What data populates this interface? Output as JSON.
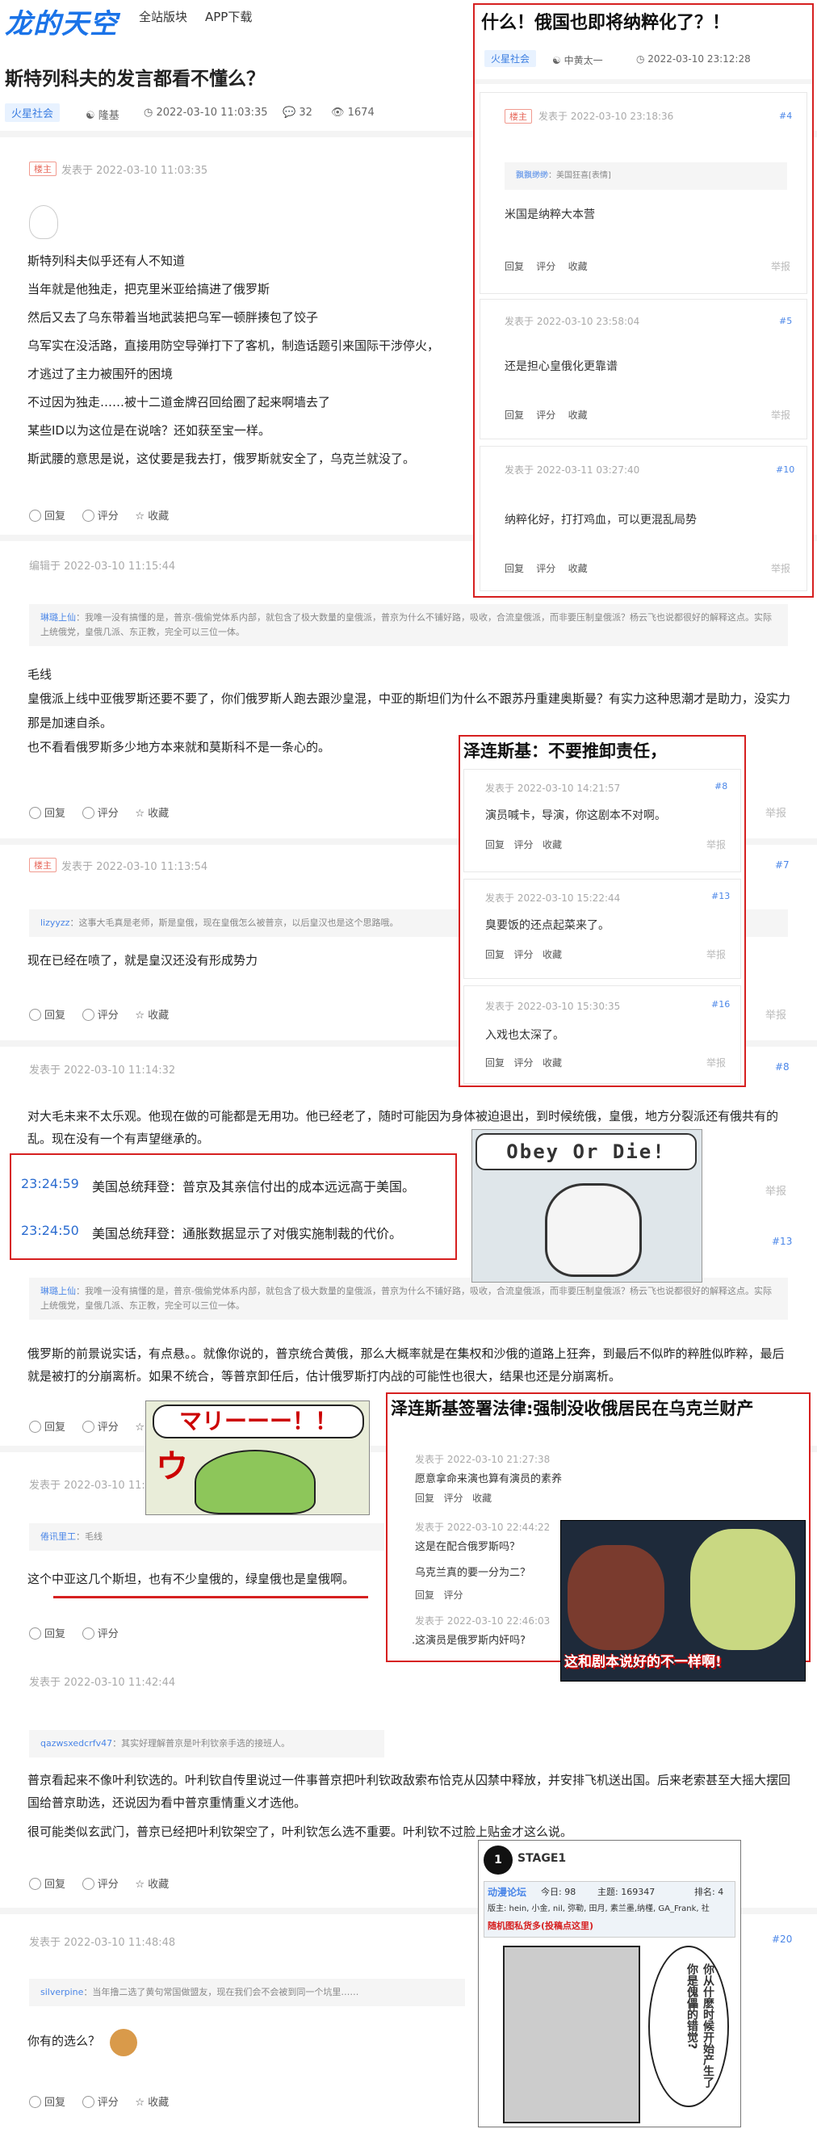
{
  "header": {
    "logo": "龙的天空",
    "nav": [
      "全站版块",
      "APP下载"
    ]
  },
  "page": {
    "title": "斯特列科夫的发言都看不懂么？",
    "tag": "火星社会",
    "author": "隆基",
    "time": "2022-03-10 11:03:35",
    "comments": "32",
    "views": "1674"
  },
  "common": {
    "louzhu": "楼主",
    "reply": "回复",
    "rate": "评分",
    "fav": "收藏",
    "report": "举报",
    "posted": "发表于"
  },
  "posts": [
    {
      "louzhu": true,
      "time": "发表于 2022-03-10 11:03:35",
      "lines": [
        "斯特列科夫似乎还有人不知道",
        "当年就是他独走，把克里米亚给搞进了俄罗斯",
        "然后又去了乌东带着当地武装把乌军一顿胖揍包了饺子",
        "乌军实在没活路，直接用防空导弹打下了客机，制造话题引来国际干涉停火，",
        "才逃过了主力被围歼的困境",
        "不过因为独走……被十二道金牌召回给圈了起来啊墙去了",
        "某些ID以为这位是在说啥？还如获至宝一样。",
        "斯武腰的意思是说，这仗要是我去打，俄罗斯就安全了，乌克兰就没了。"
      ]
    },
    {
      "time": "编辑于 2022-03-10 11:15:44",
      "quote_user": "琳璐上仙",
      "quote_text": "我唯一没有搞懂的是，普京-俄偷党体系内部，就包含了极大数量的皇俄派，普京为什么不铺好路，吸收，合流皇俄派，而非要压制皇俄派？杨云飞也说都很好的解释这点。实际上统俄党，皇俄几派、东正教，完全可以三位一体。",
      "lines": [
        "毛线",
        "皇俄派上线中亚俄罗斯还要不要了，你们俄罗斯人跑去跟沙皇混，中亚的斯坦们为什么不跟苏丹重建奥斯曼？有实力这种思潮才是助力，没实力那是加速自杀。",
        "也不看看俄罗斯多少地方本来就和莫斯科不是一条心的。"
      ]
    },
    {
      "louzhu": true,
      "time": "发表于 2022-03-10 11:13:54",
      "num": "#7",
      "quote_user": "lizyyzz",
      "quote_text": "这事大毛真是老师，斯是皇俄，现在皇俄怎么被普京，以后皇汉也是这个思路哦。",
      "lines": [
        "现在已经在喷了，就是皇汉还没有形成势力"
      ]
    },
    {
      "time": "发表于 2022-03-10 11:14:32",
      "num": "#8",
      "lines": [
        "对大毛未来不太乐观。他现在做的可能都是无用功。他已经老了，随时可能因为身体被迫退出，到时候统俄，皇俄，地方分裂派还有俄共有的乱。现在没有一个有声望继承的。"
      ]
    },
    {
      "num": "#13",
      "quote_user": "琳璐上仙",
      "quote_text": "我唯一没有搞懂的是，普京-俄偷党体系内部，就包含了极大数量的皇俄派，普京为什么不铺好路，吸收，合流皇俄派，而非要压制皇俄派？杨云飞也说都很好的解释这点。实际上统俄党，皇俄几派、东正教，完全可以三位一体。",
      "lines": [
        "俄罗斯的前景说实话，有点悬。。就像你说的，普京统合黄俄，那么大概率就是在集权和沙俄的道路上狂奔，到最后不似昨的粹胜似昨粹，最后就是被打的分崩离析。如果不统合，等普京卸任后，估计俄罗斯打内战的可能性也很大，结果也还是分崩离析。"
      ]
    },
    {
      "time": "发表于 2022-03-10 11:3",
      "quote_user": "倦讯里工",
      "quote_text": "毛线",
      "lines": [
        "这个中亚这几个斯坦，也有不少皇俄的，绿皇俄也是皇俄啊。"
      ]
    },
    {
      "time": "发表于 2022-03-10 11:42:44",
      "quote_user": "qazwsxedcrfv47",
      "quote_text": "其实好理解普京是叶利钦亲手选的接班人。",
      "lines": [
        "普京看起来不像叶利钦选的。叶利钦自传里说过一件事普京把叶利钦政敌索布恰克从囚禁中释放，并安排飞机送出国。后来老索甚至大摇大摆回国给普京助选，还说因为看中普京重情重义才选他。",
        "很可能类似玄武门，普京已经把叶利钦架空了，叶利钦怎么选不重要。叶利钦不过脸上贴金才这么说。"
      ]
    },
    {
      "time": "发表于 2022-03-10 11:48:48",
      "num": "#20",
      "quote_user": "silverpine",
      "quote_text": "当年撸二选了黄句常国做盟友，现在我们会不会被到同一个坑里……",
      "lines": [
        "你有的选么？"
      ]
    }
  ],
  "overlays": {
    "box1": {
      "title": "什么！俄国也即将纳粹化了？！",
      "tag": "火星社会",
      "author": "中黄太一",
      "time": "2022-03-10 23:12:28",
      "cards": [
        {
          "louzhu": true,
          "time": "发表于 2022-03-10 23:18:36",
          "num": "#4",
          "quote_user": "飘飘缈缈",
          "quote_text": "美国狂喜[表情]",
          "text": "米国是纳粹大本营"
        },
        {
          "time": "发表于 2022-03-10 23:58:04",
          "num": "#5",
          "text": "还是担心皇俄化更靠谱"
        },
        {
          "time": "发表于 2022-03-11 03:27:40",
          "num": "#10",
          "text": "纳粹化好，打打鸡血，可以更混乱局势"
        }
      ]
    },
    "box2": {
      "title": "泽连斯基：不要推卸责任，",
      "cards": [
        {
          "time": "发表于 2022-03-10 14:21:57",
          "num": "#8",
          "text": "演员喊卡，导演，你这剧本不对啊。"
        },
        {
          "time": "发表于 2022-03-10 15:22:44",
          "num": "#13",
          "text": "臭要饭的还点起菜来了。"
        },
        {
          "time": "发表于 2022-03-10 15:30:35",
          "num": "#16",
          "text": "入戏也太深了。"
        }
      ]
    },
    "box3": {
      "items": [
        {
          "time": "23:24:59",
          "text": "美国总统拜登：普京及其亲信付出的成本远远高于美国。"
        },
        {
          "time": "23:24:50",
          "text": "美国总统拜登：通胀数据显示了对俄实施制裁的代价。"
        }
      ]
    },
    "box4": {
      "title": "泽连斯基签署法律:强制没收俄居民在乌克兰财产",
      "cards": [
        {
          "time": "发表于 2022-03-10 21:27:38",
          "text": "愿意拿命来演也算有演员的素养"
        },
        {
          "time": "发表于 2022-03-10 22:44:22",
          "text": "这是在配合俄罗斯吗？",
          "text2": "乌克兰真的要一分为二？"
        },
        {
          "time": "发表于 2022-03-10 22:46:03",
          "text": ".这演员是俄罗斯内奸吗?"
        }
      ]
    },
    "obey": "Obey Or Die!",
    "frog": "マリーーー！！",
    "frog2": "ウ",
    "anime_caption": "这和剧本说好的不一样啊!",
    "stage": {
      "label": "STAGE1",
      "forum": "动漫论坛",
      "today": "今日: 98",
      "topic": "主题: 169347",
      "rank": "排名: 4",
      "mods": "版主: hein, 小金, nil, 弥勒, 田月, 素兰墨,纳槿, GA_Frank, 社",
      "banner": "随机图私货多(投稿点这里)",
      "bubble1": "你从什麽时候开始",
      "bubble2": "产生了你是傀儡的错觉?"
    }
  }
}
